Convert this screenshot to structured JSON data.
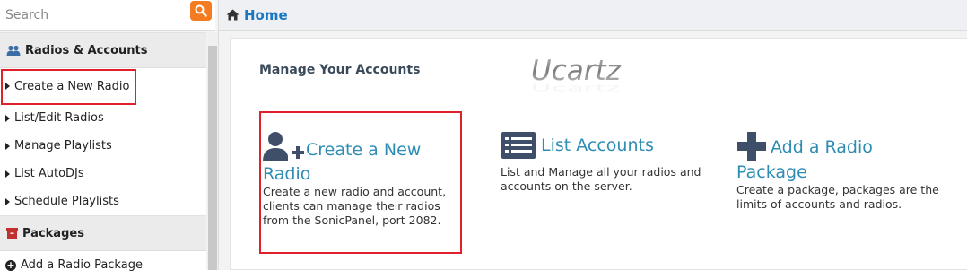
{
  "search": {
    "placeholder": "Search"
  },
  "topbar": {
    "home_label": "Home"
  },
  "sidebar": {
    "sections": [
      {
        "label": "Radios & Accounts",
        "icon": "users-icon"
      },
      {
        "label": "Packages",
        "icon": "archive-icon"
      }
    ],
    "radio_items": [
      {
        "label": "Create a New Radio"
      },
      {
        "label": "List/Edit Radios"
      },
      {
        "label": "Manage Playlists"
      },
      {
        "label": "List AutoDJs"
      },
      {
        "label": "Schedule Playlists"
      }
    ],
    "package_items": [
      {
        "label": "Add a Radio Package"
      }
    ]
  },
  "main": {
    "title": "Manage Your Accounts",
    "logo_text": "Ucartz",
    "cards": [
      {
        "title_line1": "Create a New",
        "title_line2": "Radio",
        "desc": "Create a new radio and account, clients can manage their radios from the SonicPanel, port 2082.",
        "icon": "add-user-icon"
      },
      {
        "title_line1": "List Accounts",
        "title_line2": "",
        "desc": "List and Manage all your radios and accounts on the server.",
        "icon": "list-icon"
      },
      {
        "title_line1": "Add a Radio",
        "title_line2": "Package",
        "desc": "Create a package, packages are the limits of accounts and radios.",
        "icon": "plus-icon"
      }
    ]
  },
  "colors": {
    "accent": "#2f8db4",
    "link": "#1a78c2",
    "search_button": "#f47b20",
    "highlight": "#e0202a"
  }
}
